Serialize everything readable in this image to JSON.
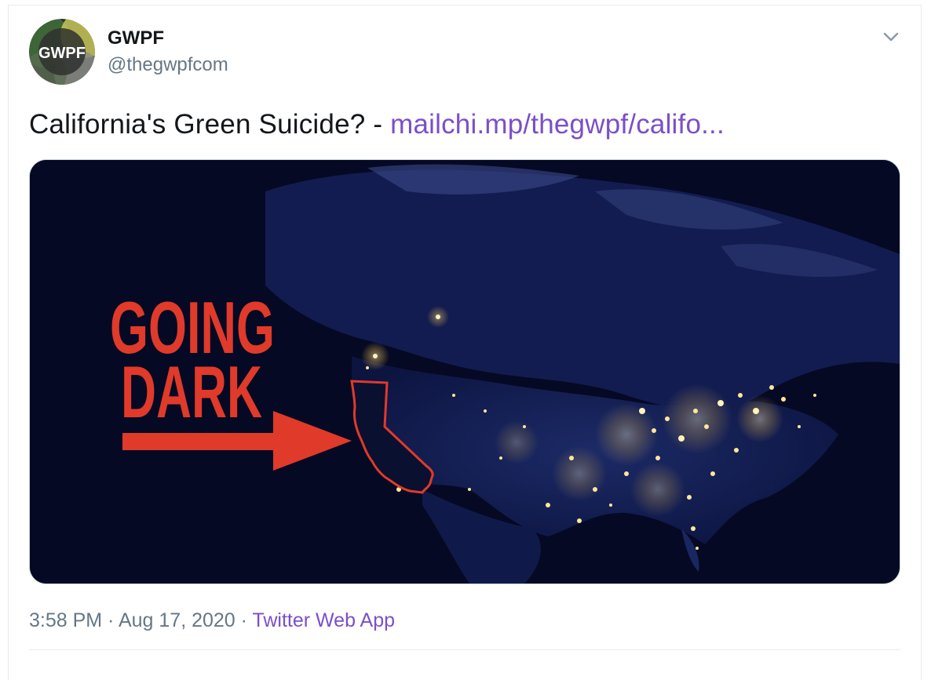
{
  "tweet": {
    "author": {
      "display_name": "GWPF",
      "handle": "@thegwpfcom",
      "avatar_text": "GWPF"
    },
    "text": "California's Green Suicide? - ",
    "link_text": "mailchi.mp/thegwpf/califo...",
    "media": {
      "headline_line1": "GOING",
      "headline_line2": "DARK"
    },
    "time": "3:58 PM",
    "separator": " · ",
    "date": "Aug 17, 2020",
    "source": "Twitter Web App"
  },
  "colors": {
    "link": "#7b4fc8",
    "headline_red": "#e03a2a",
    "map_background": "#060a24"
  },
  "icons": [
    "chevron-down-icon"
  ]
}
